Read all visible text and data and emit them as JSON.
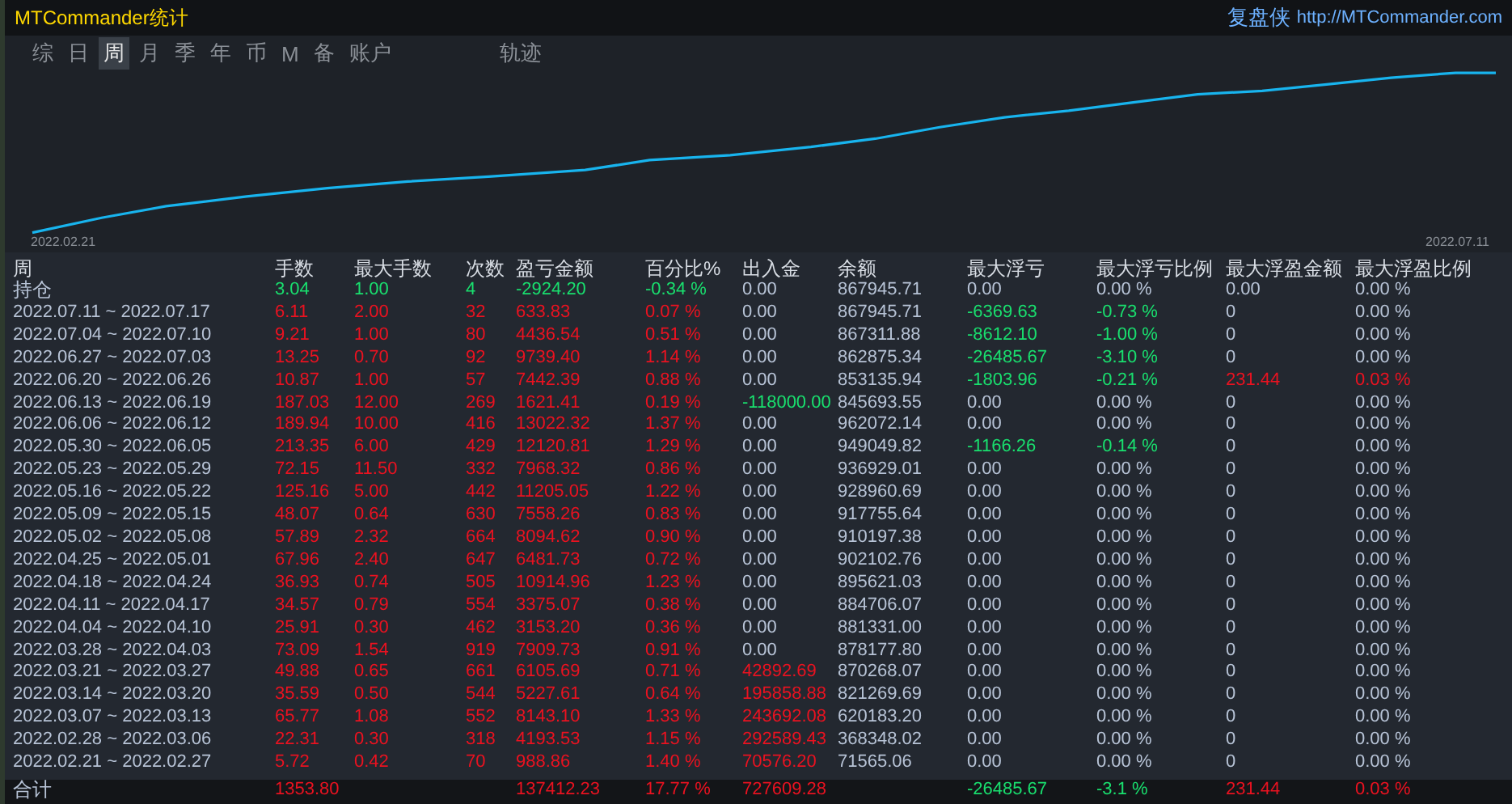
{
  "window": {
    "title": "MTCommander统计",
    "brand": "复盘侠",
    "link": "http://MTCommander.com"
  },
  "tabs": [
    {
      "label": "综",
      "selected": false
    },
    {
      "label": "日",
      "selected": false
    },
    {
      "label": "周",
      "selected": true
    },
    {
      "label": "月",
      "selected": false
    },
    {
      "label": "季",
      "selected": false
    },
    {
      "label": "年",
      "selected": false
    },
    {
      "label": "币",
      "selected": false
    },
    {
      "label": "M",
      "selected": false
    },
    {
      "label": "备",
      "selected": false
    },
    {
      "label": "账户",
      "selected": false
    },
    {
      "label": "轨迹",
      "selected": false
    }
  ],
  "chart": {
    "start_label": "2022.02.21",
    "end_label": "2022.07.11"
  },
  "table": {
    "columns": [
      "周",
      "手数",
      "最大手数",
      "次数",
      "盈亏金额",
      "百分比%",
      "出入金",
      "余额",
      "最大浮亏",
      "最大浮亏比例",
      "最大浮盈金额",
      "最大浮盈比例"
    ],
    "rows": [
      {
        "cells": [
          {
            "text": "持仓"
          },
          {
            "text": "3.04",
            "color": "#19df6e"
          },
          {
            "text": "1.00",
            "color": "#19df6e"
          },
          {
            "text": "4",
            "color": "#19df6e"
          },
          {
            "text": "-2924.20",
            "color": "#19df6e"
          },
          {
            "text": "-0.34 %",
            "color": "#19df6e"
          },
          {
            "text": "0.00"
          },
          {
            "text": "867945.71"
          },
          {
            "text": "0.00"
          },
          {
            "text": "0.00 %"
          },
          {
            "text": "0.00"
          },
          {
            "text": "0.00 %"
          }
        ]
      },
      {
        "cells": [
          {
            "text": "2022.07.11 ~ 2022.07.17"
          },
          {
            "text": "6.11",
            "color": "#ea1220"
          },
          {
            "text": "2.00",
            "color": "#ea1220"
          },
          {
            "text": "32",
            "color": "#ea1220"
          },
          {
            "text": "633.83",
            "color": "#ea1220"
          },
          {
            "text": "0.07 %",
            "color": "#ea1220"
          },
          {
            "text": "0.00"
          },
          {
            "text": "867945.71"
          },
          {
            "text": "-6369.63",
            "color": "#19df6e"
          },
          {
            "text": "-0.73 %",
            "color": "#19df6e"
          },
          {
            "text": "0"
          },
          {
            "text": "0.00 %"
          }
        ]
      },
      {
        "cells": [
          {
            "text": "2022.07.04 ~ 2022.07.10"
          },
          {
            "text": "9.21",
            "color": "#ea1220"
          },
          {
            "text": "1.00",
            "color": "#ea1220"
          },
          {
            "text": "80",
            "color": "#ea1220"
          },
          {
            "text": "4436.54",
            "color": "#ea1220"
          },
          {
            "text": "0.51 %",
            "color": "#ea1220"
          },
          {
            "text": "0.00"
          },
          {
            "text": "867311.88"
          },
          {
            "text": "-8612.10",
            "color": "#19df6e"
          },
          {
            "text": "-1.00 %",
            "color": "#19df6e"
          },
          {
            "text": "0"
          },
          {
            "text": "0.00 %"
          }
        ]
      },
      {
        "cells": [
          {
            "text": "2022.06.27 ~ 2022.07.03"
          },
          {
            "text": "13.25",
            "color": "#ea1220"
          },
          {
            "text": "0.70",
            "color": "#ea1220"
          },
          {
            "text": "92",
            "color": "#ea1220"
          },
          {
            "text": "9739.40",
            "color": "#ea1220"
          },
          {
            "text": "1.14 %",
            "color": "#ea1220"
          },
          {
            "text": "0.00"
          },
          {
            "text": "862875.34"
          },
          {
            "text": "-26485.67",
            "color": "#19df6e"
          },
          {
            "text": "-3.10 %",
            "color": "#19df6e"
          },
          {
            "text": "0"
          },
          {
            "text": "0.00 %"
          }
        ]
      },
      {
        "cells": [
          {
            "text": "2022.06.20 ~ 2022.06.26"
          },
          {
            "text": "10.87",
            "color": "#ea1220"
          },
          {
            "text": "1.00",
            "color": "#ea1220"
          },
          {
            "text": "57",
            "color": "#ea1220"
          },
          {
            "text": "7442.39",
            "color": "#ea1220"
          },
          {
            "text": "0.88 %",
            "color": "#ea1220"
          },
          {
            "text": "0.00"
          },
          {
            "text": "853135.94"
          },
          {
            "text": "-1803.96",
            "color": "#19df6e"
          },
          {
            "text": "-0.21 %",
            "color": "#19df6e"
          },
          {
            "text": "231.44",
            "color": "#ea1220"
          },
          {
            "text": "0.03 %",
            "color": "#ea1220"
          }
        ]
      },
      {
        "cells": [
          {
            "text": "2022.06.13 ~ 2022.06.19"
          },
          {
            "text": "187.03",
            "color": "#ea1220"
          },
          {
            "text": "12.00",
            "color": "#ea1220"
          },
          {
            "text": "269",
            "color": "#ea1220"
          },
          {
            "text": "1621.41",
            "color": "#ea1220"
          },
          {
            "text": "0.19 %",
            "color": "#ea1220"
          },
          {
            "text": "-118000.00",
            "color": "#19df6e"
          },
          {
            "text": "845693.55"
          },
          {
            "text": "0.00"
          },
          {
            "text": "0.00 %"
          },
          {
            "text": "0"
          },
          {
            "text": "0.00 %"
          }
        ]
      },
      {
        "cells": [
          {
            "text": "2022.06.06 ~ 2022.06.12"
          },
          {
            "text": "189.94",
            "color": "#ea1220"
          },
          {
            "text": "10.00",
            "color": "#ea1220"
          },
          {
            "text": "416",
            "color": "#ea1220"
          },
          {
            "text": "13022.32",
            "color": "#ea1220"
          },
          {
            "text": "1.37 %",
            "color": "#ea1220"
          },
          {
            "text": "0.00"
          },
          {
            "text": "962072.14"
          },
          {
            "text": "0.00"
          },
          {
            "text": "0.00 %"
          },
          {
            "text": "0"
          },
          {
            "text": "0.00 %"
          }
        ]
      },
      {
        "cells": [
          {
            "text": "2022.05.30 ~ 2022.06.05"
          },
          {
            "text": "213.35",
            "color": "#ea1220"
          },
          {
            "text": "6.00",
            "color": "#ea1220"
          },
          {
            "text": "429",
            "color": "#ea1220"
          },
          {
            "text": "12120.81",
            "color": "#ea1220"
          },
          {
            "text": "1.29 %",
            "color": "#ea1220"
          },
          {
            "text": "0.00"
          },
          {
            "text": "949049.82"
          },
          {
            "text": "-1166.26",
            "color": "#19df6e"
          },
          {
            "text": "-0.14 %",
            "color": "#19df6e"
          },
          {
            "text": "0"
          },
          {
            "text": "0.00 %"
          }
        ]
      },
      {
        "cells": [
          {
            "text": "2022.05.23 ~ 2022.05.29"
          },
          {
            "text": "72.15",
            "color": "#ea1220"
          },
          {
            "text": "11.50",
            "color": "#ea1220"
          },
          {
            "text": "332",
            "color": "#ea1220"
          },
          {
            "text": "7968.32",
            "color": "#ea1220"
          },
          {
            "text": "0.86 %",
            "color": "#ea1220"
          },
          {
            "text": "0.00"
          },
          {
            "text": "936929.01"
          },
          {
            "text": "0.00"
          },
          {
            "text": "0.00 %"
          },
          {
            "text": "0"
          },
          {
            "text": "0.00 %"
          }
        ]
      },
      {
        "cells": [
          {
            "text": "2022.05.16 ~ 2022.05.22"
          },
          {
            "text": "125.16",
            "color": "#ea1220"
          },
          {
            "text": "5.00",
            "color": "#ea1220"
          },
          {
            "text": "442",
            "color": "#ea1220"
          },
          {
            "text": "11205.05",
            "color": "#ea1220"
          },
          {
            "text": "1.22 %",
            "color": "#ea1220"
          },
          {
            "text": "0.00"
          },
          {
            "text": "928960.69"
          },
          {
            "text": "0.00"
          },
          {
            "text": "0.00 %"
          },
          {
            "text": "0"
          },
          {
            "text": "0.00 %"
          }
        ]
      },
      {
        "cells": [
          {
            "text": "2022.05.09 ~ 2022.05.15"
          },
          {
            "text": "48.07",
            "color": "#ea1220"
          },
          {
            "text": "0.64",
            "color": "#ea1220"
          },
          {
            "text": "630",
            "color": "#ea1220"
          },
          {
            "text": "7558.26",
            "color": "#ea1220"
          },
          {
            "text": "0.83 %",
            "color": "#ea1220"
          },
          {
            "text": "0.00"
          },
          {
            "text": "917755.64"
          },
          {
            "text": "0.00"
          },
          {
            "text": "0.00 %"
          },
          {
            "text": "0"
          },
          {
            "text": "0.00 %"
          }
        ]
      },
      {
        "cells": [
          {
            "text": "2022.05.02 ~ 2022.05.08"
          },
          {
            "text": "57.89",
            "color": "#ea1220"
          },
          {
            "text": "2.32",
            "color": "#ea1220"
          },
          {
            "text": "664",
            "color": "#ea1220"
          },
          {
            "text": "8094.62",
            "color": "#ea1220"
          },
          {
            "text": "0.90 %",
            "color": "#ea1220"
          },
          {
            "text": "0.00"
          },
          {
            "text": "910197.38"
          },
          {
            "text": "0.00"
          },
          {
            "text": "0.00 %"
          },
          {
            "text": "0"
          },
          {
            "text": "0.00 %"
          }
        ]
      },
      {
        "cells": [
          {
            "text": "2022.04.25 ~ 2022.05.01"
          },
          {
            "text": "67.96",
            "color": "#ea1220"
          },
          {
            "text": "2.40",
            "color": "#ea1220"
          },
          {
            "text": "647",
            "color": "#ea1220"
          },
          {
            "text": "6481.73",
            "color": "#ea1220"
          },
          {
            "text": "0.72 %",
            "color": "#ea1220"
          },
          {
            "text": "0.00"
          },
          {
            "text": "902102.76"
          },
          {
            "text": "0.00"
          },
          {
            "text": "0.00 %"
          },
          {
            "text": "0"
          },
          {
            "text": "0.00 %"
          }
        ]
      },
      {
        "cells": [
          {
            "text": "2022.04.18 ~ 2022.04.24"
          },
          {
            "text": "36.93",
            "color": "#ea1220"
          },
          {
            "text": "0.74",
            "color": "#ea1220"
          },
          {
            "text": "505",
            "color": "#ea1220"
          },
          {
            "text": "10914.96",
            "color": "#ea1220"
          },
          {
            "text": "1.23 %",
            "color": "#ea1220"
          },
          {
            "text": "0.00"
          },
          {
            "text": "895621.03"
          },
          {
            "text": "0.00"
          },
          {
            "text": "0.00 %"
          },
          {
            "text": "0"
          },
          {
            "text": "0.00 %"
          }
        ]
      },
      {
        "cells": [
          {
            "text": "2022.04.11 ~ 2022.04.17"
          },
          {
            "text": "34.57",
            "color": "#ea1220"
          },
          {
            "text": "0.79",
            "color": "#ea1220"
          },
          {
            "text": "554",
            "color": "#ea1220"
          },
          {
            "text": "3375.07",
            "color": "#ea1220"
          },
          {
            "text": "0.38 %",
            "color": "#ea1220"
          },
          {
            "text": "0.00"
          },
          {
            "text": "884706.07"
          },
          {
            "text": "0.00"
          },
          {
            "text": "0.00 %"
          },
          {
            "text": "0"
          },
          {
            "text": "0.00 %"
          }
        ]
      },
      {
        "cells": [
          {
            "text": "2022.04.04 ~ 2022.04.10"
          },
          {
            "text": "25.91",
            "color": "#ea1220"
          },
          {
            "text": "0.30",
            "color": "#ea1220"
          },
          {
            "text": "462",
            "color": "#ea1220"
          },
          {
            "text": "3153.20",
            "color": "#ea1220"
          },
          {
            "text": "0.36 %",
            "color": "#ea1220"
          },
          {
            "text": "0.00"
          },
          {
            "text": "881331.00"
          },
          {
            "text": "0.00"
          },
          {
            "text": "0.00 %"
          },
          {
            "text": "0"
          },
          {
            "text": "0.00 %"
          }
        ]
      },
      {
        "cells": [
          {
            "text": "2022.03.28 ~ 2022.04.03"
          },
          {
            "text": "73.09",
            "color": "#ea1220"
          },
          {
            "text": "1.54",
            "color": "#ea1220"
          },
          {
            "text": "919",
            "color": "#ea1220"
          },
          {
            "text": "7909.73",
            "color": "#ea1220"
          },
          {
            "text": "0.91 %",
            "color": "#ea1220"
          },
          {
            "text": "0.00"
          },
          {
            "text": "878177.80"
          },
          {
            "text": "0.00"
          },
          {
            "text": "0.00 %"
          },
          {
            "text": "0"
          },
          {
            "text": "0.00 %"
          }
        ]
      },
      {
        "cells": [
          {
            "text": "2022.03.21 ~ 2022.03.27"
          },
          {
            "text": "49.88",
            "color": "#ea1220"
          },
          {
            "text": "0.65",
            "color": "#ea1220"
          },
          {
            "text": "661",
            "color": "#ea1220"
          },
          {
            "text": "6105.69",
            "color": "#ea1220"
          },
          {
            "text": "0.71 %",
            "color": "#ea1220"
          },
          {
            "text": "42892.69",
            "color": "#ea1220"
          },
          {
            "text": "870268.07"
          },
          {
            "text": "0.00"
          },
          {
            "text": "0.00 %"
          },
          {
            "text": "0"
          },
          {
            "text": "0.00 %"
          }
        ]
      },
      {
        "cells": [
          {
            "text": "2022.03.14 ~ 2022.03.20"
          },
          {
            "text": "35.59",
            "color": "#ea1220"
          },
          {
            "text": "0.50",
            "color": "#ea1220"
          },
          {
            "text": "544",
            "color": "#ea1220"
          },
          {
            "text": "5227.61",
            "color": "#ea1220"
          },
          {
            "text": "0.64 %",
            "color": "#ea1220"
          },
          {
            "text": "195858.88",
            "color": "#ea1220"
          },
          {
            "text": "821269.69"
          },
          {
            "text": "0.00"
          },
          {
            "text": "0.00 %"
          },
          {
            "text": "0"
          },
          {
            "text": "0.00 %"
          }
        ]
      },
      {
        "cells": [
          {
            "text": "2022.03.07 ~ 2022.03.13"
          },
          {
            "text": "65.77",
            "color": "#ea1220"
          },
          {
            "text": "1.08",
            "color": "#ea1220"
          },
          {
            "text": "552",
            "color": "#ea1220"
          },
          {
            "text": "8143.10",
            "color": "#ea1220"
          },
          {
            "text": "1.33 %",
            "color": "#ea1220"
          },
          {
            "text": "243692.08",
            "color": "#ea1220"
          },
          {
            "text": "620183.20"
          },
          {
            "text": "0.00"
          },
          {
            "text": "0.00 %"
          },
          {
            "text": "0"
          },
          {
            "text": "0.00 %"
          }
        ]
      },
      {
        "cells": [
          {
            "text": "2022.02.28 ~ 2022.03.06"
          },
          {
            "text": "22.31",
            "color": "#ea1220"
          },
          {
            "text": "0.30",
            "color": "#ea1220"
          },
          {
            "text": "318",
            "color": "#ea1220"
          },
          {
            "text": "4193.53",
            "color": "#ea1220"
          },
          {
            "text": "1.15 %",
            "color": "#ea1220"
          },
          {
            "text": "292589.43",
            "color": "#ea1220"
          },
          {
            "text": "368348.02"
          },
          {
            "text": "0.00"
          },
          {
            "text": "0.00 %"
          },
          {
            "text": "0"
          },
          {
            "text": "0.00 %"
          }
        ]
      },
      {
        "cells": [
          {
            "text": "2022.02.21 ~ 2022.02.27"
          },
          {
            "text": "5.72",
            "color": "#ea1220"
          },
          {
            "text": "0.42",
            "color": "#ea1220"
          },
          {
            "text": "70",
            "color": "#ea1220"
          },
          {
            "text": "988.86",
            "color": "#ea1220"
          },
          {
            "text": "1.40 %",
            "color": "#ea1220"
          },
          {
            "text": "70576.20",
            "color": "#ea1220"
          },
          {
            "text": "71565.06"
          },
          {
            "text": "0.00"
          },
          {
            "text": "0.00 %"
          },
          {
            "text": "0"
          },
          {
            "text": "0.00 %"
          }
        ]
      }
    ],
    "total": {
      "cells": [
        {
          "text": "合计"
        },
        {
          "text": "1353.80",
          "color": "#ea1220"
        },
        null,
        null,
        {
          "text": "137412.23",
          "color": "#ea1220"
        },
        {
          "text": "17.77 %",
          "color": "#ea1220"
        },
        {
          "text": "727609.28",
          "color": "#ea1220"
        },
        null,
        {
          "text": "-26485.67",
          "color": "#19df6e"
        },
        {
          "text": "-3.1 %",
          "color": "#19df6e"
        },
        {
          "text": "231.44",
          "color": "#ea1220"
        },
        {
          "text": "0.03 %",
          "color": "#ea1220"
        }
      ]
    }
  }
}
